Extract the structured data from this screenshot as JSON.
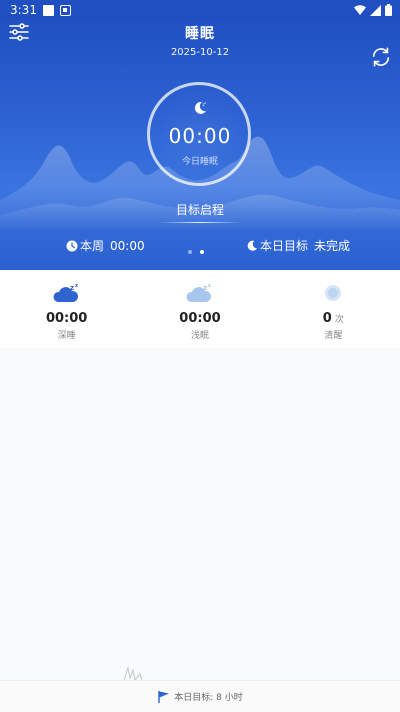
{
  "status_bar": {
    "time": "3:31"
  },
  "header": {
    "title": "睡眠",
    "date": "2025-10-12"
  },
  "today": {
    "time": "00:00",
    "label": "今日睡眠"
  },
  "goal_start_label": "目标启程",
  "week": {
    "label": "本周",
    "time": "00:00"
  },
  "daily_goal": {
    "label": "本日目标",
    "status": "未完成"
  },
  "stats": [
    {
      "icon": "deep-sleep-icon",
      "value": "00:00",
      "unit": "",
      "label": "深睡"
    },
    {
      "icon": "light-sleep-icon",
      "value": "00:00",
      "unit": "",
      "label": "浅眠"
    },
    {
      "icon": "awake-icon",
      "value": "0",
      "unit": "次",
      "label": "清醒"
    }
  ],
  "footer": {
    "goal_text": "本日目标: 8 小时"
  },
  "colors": {
    "hero": "#2e63d4",
    "accent": "#3a74e0",
    "deep_icon": "#2f64d0",
    "light_icon": "#a9c6ee"
  }
}
